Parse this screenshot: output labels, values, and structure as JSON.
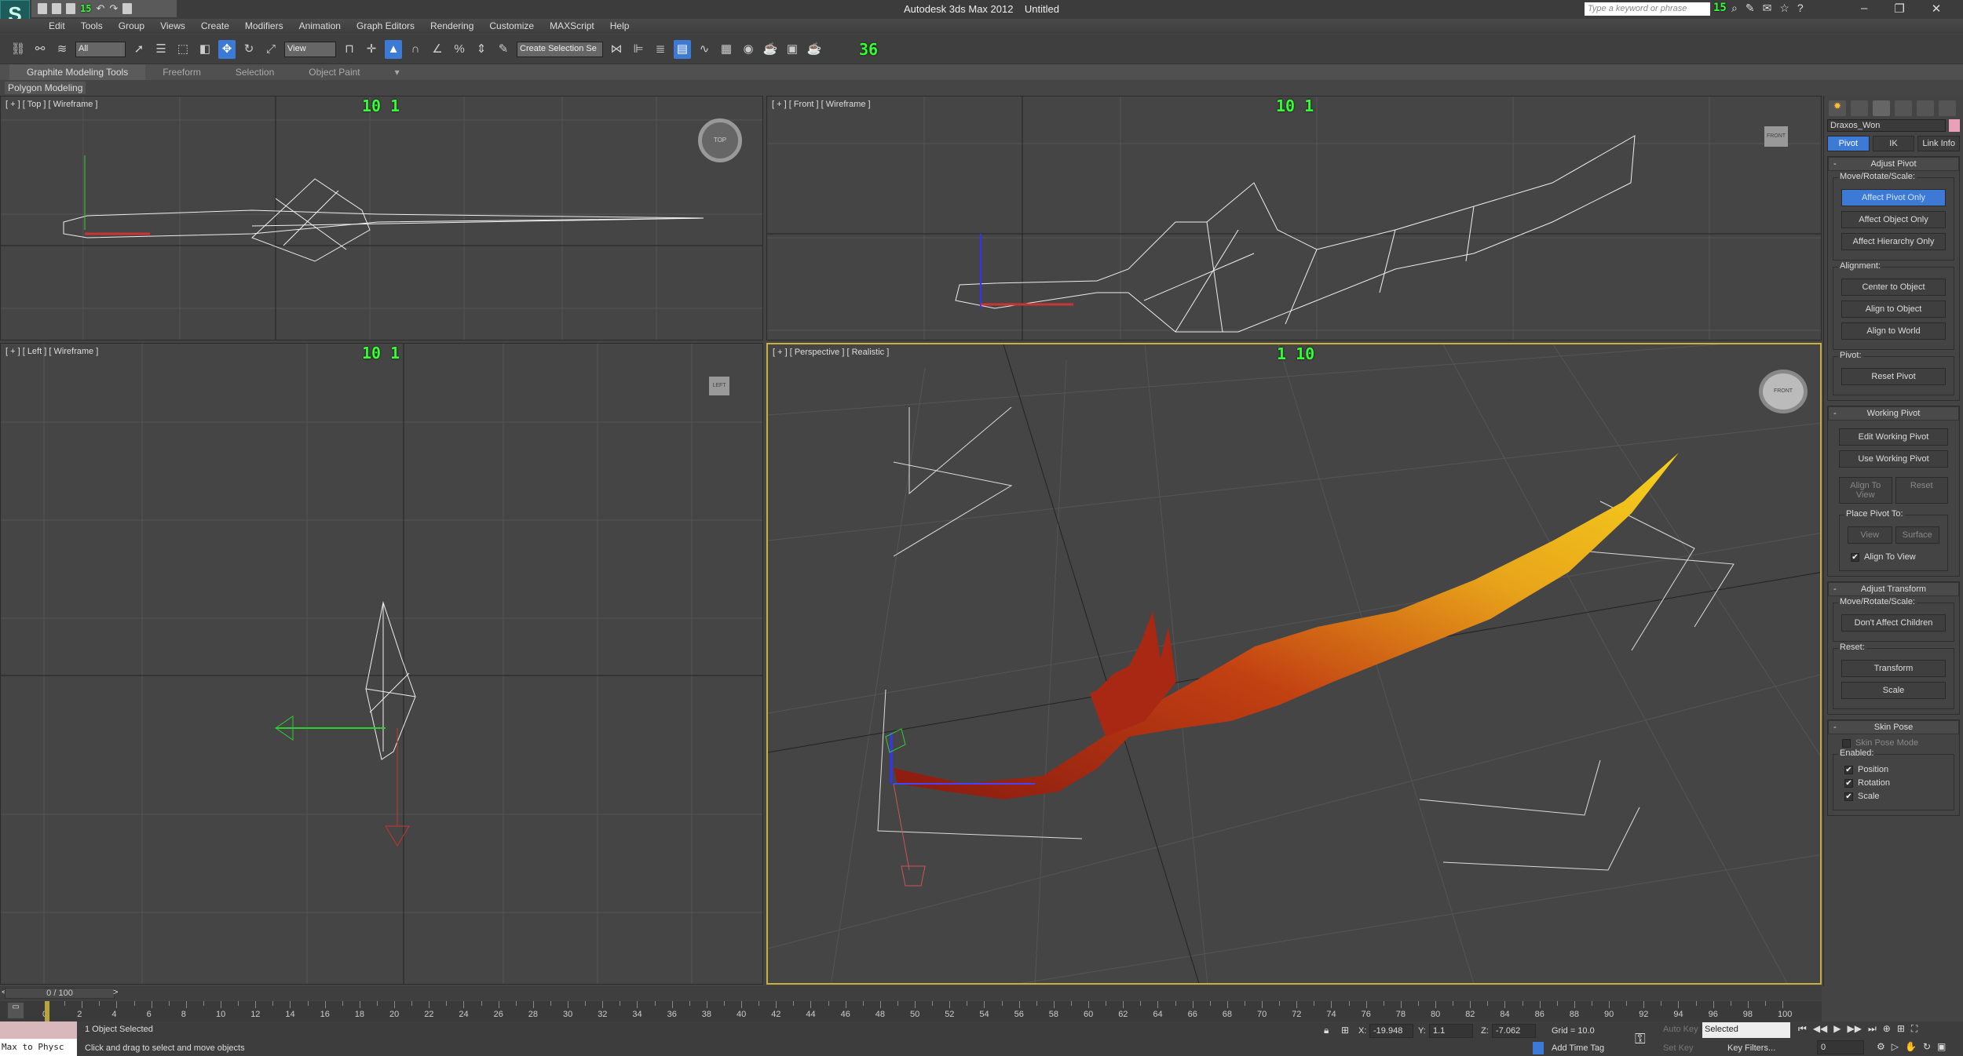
{
  "window": {
    "app_title": "Autodesk 3ds Max 2012",
    "doc_title": "Untitled",
    "search_placeholder": "Type a keyword or phrase",
    "fps_title": "15",
    "fps_search": "15"
  },
  "menu": [
    "Edit",
    "Tools",
    "Group",
    "Views",
    "Create",
    "Modifiers",
    "Animation",
    "Graph Editors",
    "Rendering",
    "Customize",
    "MAXScript",
    "Help"
  ],
  "toolbar": {
    "selection_filter": "All",
    "ref_coord": "View",
    "named_selection": "Create Selection Se",
    "fps": "36"
  },
  "ribbon": {
    "tabs": [
      "Graphite Modeling Tools",
      "Freeform",
      "Selection",
      "Object Paint"
    ],
    "active": "Graphite Modeling Tools",
    "panel": "Polygon Modeling"
  },
  "viewports": [
    {
      "label": "[ + ] [ Top ] [ Wireframe ]",
      "fps": "10 1",
      "cube": "TOP"
    },
    {
      "label": "[ + ] [ Front ] [ Wireframe ]",
      "fps": "10 1",
      "cube": "FRONT"
    },
    {
      "label": "[ + ] [ Left ] [ Wireframe ]",
      "fps": "10 1",
      "cube": "LEFT"
    },
    {
      "label": "[ + ] [ Perspective ] [ Realistic ]",
      "fps": "1 10",
      "cube": "FRONT"
    }
  ],
  "command_panel": {
    "object_name": "Draxos_Won",
    "object_color": "#e9a0b8",
    "subtabs": [
      "Pivot",
      "IK",
      "Link Info"
    ],
    "active_subtab": "Pivot",
    "adjust_pivot": {
      "title": "Adjust Pivot",
      "mrs_label": "Move/Rotate/Scale:",
      "mrs_buttons": [
        "Affect Pivot Only",
        "Affect Object Only",
        "Affect Hierarchy Only"
      ],
      "alignment_label": "Alignment:",
      "alignment_buttons": [
        "Center to Object",
        "Align to Object",
        "Align to World"
      ],
      "pivot_label": "Pivot:",
      "reset_pivot": "Reset Pivot"
    },
    "working_pivot": {
      "title": "Working Pivot",
      "edit": "Edit Working Pivot",
      "use": "Use Working Pivot",
      "align_to_view": "Align To View",
      "reset": "Reset",
      "place_label": "Place Pivot To:",
      "view": "View",
      "surface": "Surface",
      "align_check": "Align To View",
      "align_checked": true
    },
    "adjust_transform": {
      "title": "Adjust Transform",
      "mrs_label": "Move/Rotate/Scale:",
      "dont_affect": "Don't Affect Children",
      "reset_label": "Reset:",
      "transform": "Transform",
      "scale": "Scale"
    },
    "skin_pose": {
      "title": "Skin Pose",
      "mode": "Skin Pose Mode",
      "mode_checked": false,
      "enabled_label": "Enabled:",
      "position": "Position",
      "rotation": "Rotation",
      "scale": "Scale",
      "position_checked": true,
      "rotation_checked": true,
      "scale_checked": true
    }
  },
  "timeline": {
    "frame_display": "0 / 100",
    "prev": "<",
    "next": ">",
    "ticks": [
      "0",
      "2",
      "4",
      "6",
      "8",
      "10",
      "12",
      "14",
      "16",
      "18",
      "20",
      "22",
      "24",
      "26",
      "28",
      "30",
      "32",
      "34",
      "36",
      "38",
      "40",
      "42",
      "44",
      "46",
      "48",
      "50",
      "52",
      "54",
      "56",
      "58",
      "60",
      "62",
      "64",
      "66",
      "68",
      "70",
      "72",
      "74",
      "76",
      "78",
      "80",
      "82",
      "84",
      "86",
      "88",
      "90",
      "92",
      "94",
      "96",
      "98",
      "100"
    ],
    "current_frame": 0
  },
  "status": {
    "maxscript": "Max to Physc",
    "selected": "1 Object Selected",
    "prompt": "Click and drag to select and move objects",
    "x_label": "X:",
    "x": "-19.948",
    "y_label": "Y:",
    "y": "1.1",
    "z_label": "Z:",
    "z": "-7.062",
    "grid": "Grid = 10.0",
    "add_time_tag": "Add Time Tag",
    "auto_key": "Auto Key",
    "set_key": "Set Key",
    "key_mode": "Selected",
    "key_filters": "Key Filters...",
    "frame": "0"
  }
}
